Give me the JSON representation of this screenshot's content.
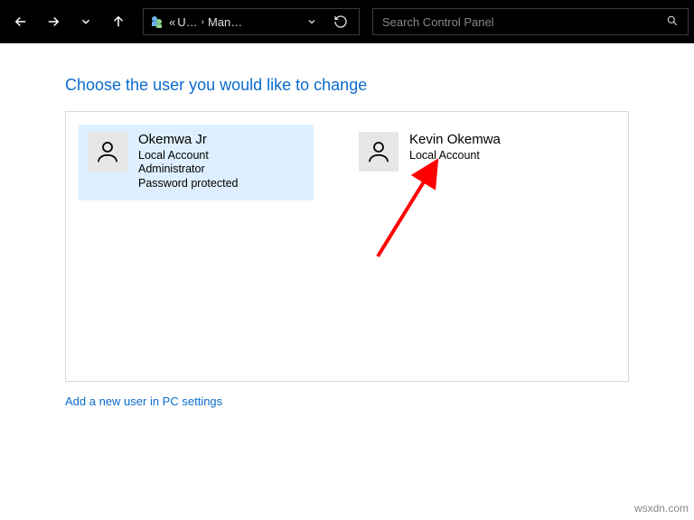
{
  "titlebar": {
    "breadcrumb": {
      "prefix": "«",
      "part1": "U…",
      "part2": "Man…"
    },
    "search_placeholder": "Search Control Panel"
  },
  "content": {
    "heading": "Choose the user you would like to change",
    "users": [
      {
        "name": "Okemwa Jr",
        "type": "Local Account",
        "role": "Administrator",
        "pw": "Password protected"
      },
      {
        "name": "Kevin Okemwa",
        "type": "Local Account"
      }
    ],
    "add_link": "Add a new user in PC settings"
  },
  "watermark": "wsxdn.com"
}
